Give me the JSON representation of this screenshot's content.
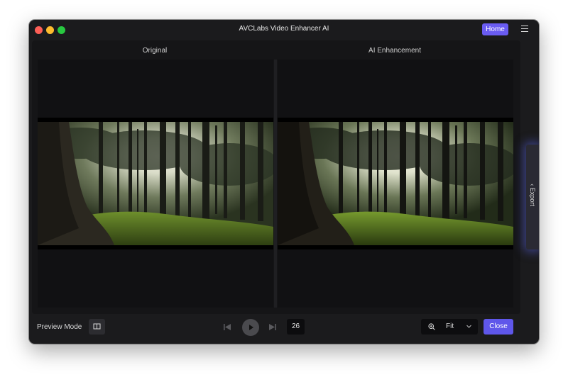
{
  "window": {
    "title": "AVCLabs Video Enhancer AI"
  },
  "header": {
    "home_label": "Home",
    "menu_icon": "hamburger-menu-icon"
  },
  "preview": {
    "original_label": "Original",
    "enhanced_label": "AI Enhancement",
    "scene": "forest-sunlight"
  },
  "sidebar": {
    "export_label": "Export"
  },
  "bottom": {
    "preview_mode_label": "Preview Mode",
    "frame_number": "26",
    "zoom_value": "Fit",
    "close_label": "Close"
  },
  "colors": {
    "accent": "#6a5cf2",
    "window_bg": "#1b1b1d",
    "panel_bg": "#151517"
  }
}
